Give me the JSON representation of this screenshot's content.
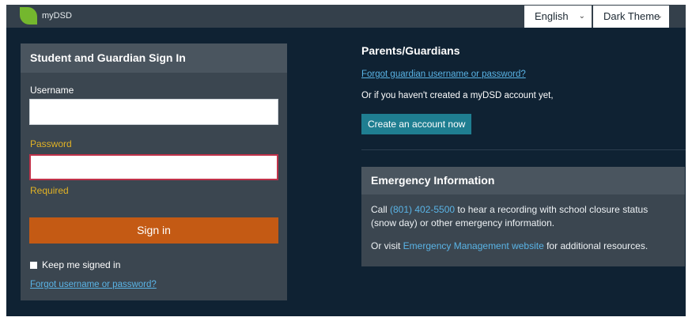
{
  "topbar": {
    "logo_text": "myDSD",
    "language": "English",
    "theme": "Dark Theme"
  },
  "signin": {
    "title": "Student and Guardian Sign In",
    "username_label": "Username",
    "password_label": "Password",
    "required_text": "Required",
    "signin_label": "Sign in",
    "keep_label": "Keep me signed in",
    "forgot_label": "Forgot username or password?"
  },
  "parents": {
    "title": "Parents/Guardians",
    "forgot_link": "Forgot guardian username or password?",
    "no_account_text": "Or if you haven't created a myDSD account yet,",
    "create_label": "Create an account now"
  },
  "emergency": {
    "title": "Emergency Information",
    "call_prefix": "Call ",
    "phone": "(801) 402-5500",
    "call_suffix": " to hear a recording with school closure status (snow day) or other emergency information.",
    "visit_prefix": "Or visit ",
    "mgmt_link": "Emergency Management website",
    "visit_suffix": " for additional resources."
  },
  "colors": {
    "background": "#0f2233",
    "topbar": "#34404b",
    "panel": "#3b4650",
    "accent_orange": "#c45a14",
    "accent_teal": "#1f7e91",
    "link": "#5ab4e6",
    "warning": "#e1b225"
  }
}
